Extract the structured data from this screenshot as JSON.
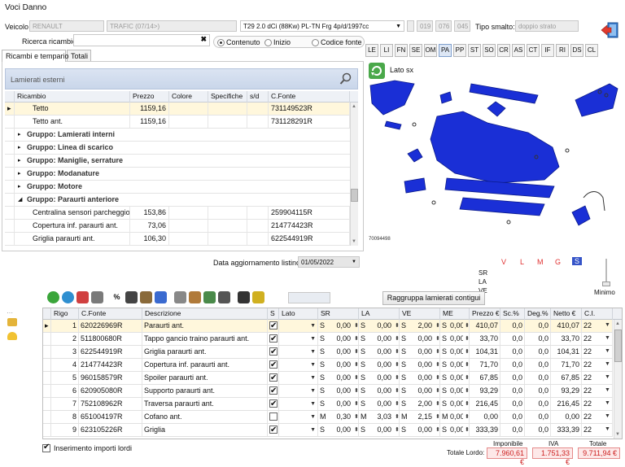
{
  "window": {
    "title": "Voci Danno"
  },
  "header": {
    "veicolo_label": "Veicolo",
    "make": "RENAULT",
    "model": "TRAFIC (07/14>)",
    "version": "T29 2.0 dCi (88Kw) PL-TN Frg 4p/d/1997cc",
    "codes": [
      "019",
      "076",
      "045"
    ],
    "smalto_label": "Tipo smalto:",
    "smalto_value": "doppio strato"
  },
  "search": {
    "label": "Ricerca ricambio",
    "value": "",
    "clear": "✖"
  },
  "search_mode": {
    "options": [
      "Contenuto",
      "Inizio",
      "Codice fonte"
    ],
    "selected": "Contenuto"
  },
  "left_tabs": [
    "Ricambi e tempario",
    "Totali"
  ],
  "group_title": "Lamierati esterni",
  "parts_columns": [
    "Ricambio",
    "Prezzo",
    "Colore",
    "Specifiche",
    "s/d",
    "C.Fonte"
  ],
  "parts_rows": [
    {
      "type": "item",
      "name": "Tetto",
      "price": "1159,16",
      "code": "731149523R",
      "current": true
    },
    {
      "type": "item",
      "name": "Tetto ant.",
      "price": "1159,16",
      "code": "731128291R"
    },
    {
      "type": "group",
      "name": "Gruppo: Lamierati interni"
    },
    {
      "type": "group",
      "name": "Gruppo: Linea di scarico"
    },
    {
      "type": "group",
      "name": "Gruppo: Maniglie, serrature"
    },
    {
      "type": "group",
      "name": "Gruppo: Modanature"
    },
    {
      "type": "group",
      "name": "Gruppo: Motore"
    },
    {
      "type": "group",
      "name": "Gruppo: Paraurti anteriore",
      "expanded": true
    },
    {
      "type": "item",
      "name": "Centralina sensori parcheggio",
      "price": "153,86",
      "code": "259904115R"
    },
    {
      "type": "item",
      "name": "Copertura inf. paraurti ant.",
      "price": "73,06",
      "code": "214774423R"
    },
    {
      "type": "item",
      "name": "Griglia paraurti ant.",
      "price": "106,30",
      "code": "622544919R"
    }
  ],
  "section_tabs": [
    "LE",
    "LI",
    "FN",
    "SE",
    "OM",
    "PA",
    "PP",
    "ST",
    "SO",
    "CR",
    "AS",
    "CT",
    "IF",
    "RI",
    "DS",
    "CL"
  ],
  "section_selected": "PA",
  "view": {
    "side_label": "Lato sx",
    "image_code": "70094498"
  },
  "legend": {
    "letters": [
      "V",
      "L",
      "M",
      "G",
      "S"
    ],
    "selected": "S",
    "row_labels": [
      "SR",
      "LA",
      "VE"
    ],
    "minimo_label": "Minimo"
  },
  "listino": {
    "label": "Data aggiornamento listino:",
    "date": "01/05/2022"
  },
  "group_button": "Raggruppa lamierati contigui",
  "toolbar_icons": [
    "add-icon",
    "refresh-icon",
    "eraser-icon",
    "calculator-icon",
    "percent-icon",
    "document-icon",
    "diamond-icon",
    "grid-icon",
    "gear-icon",
    "box-icon",
    "image-icon",
    "binoculars-icon",
    "motorcycle-icon",
    "barcode-icon"
  ],
  "labor_columns": [
    "Rigo",
    "C.Fonte",
    "Descrizione",
    "S",
    "Lato",
    "SR",
    "LA",
    "VE",
    "ME",
    "Prezzo €",
    "Sc.%",
    "Deg.%",
    "Netto €",
    "C.I."
  ],
  "labor_rows": [
    {
      "rigo": "1",
      "code": "620226969R",
      "desc": "Paraurti ant.",
      "s": true,
      "lato": "",
      "sr_op": "S",
      "sr": "0,00",
      "la_op": "S",
      "la": "0,00",
      "ve_op": "S",
      "ve": "2,00",
      "me_op": "S",
      "me": "0,00",
      "price": "410,07",
      "sc": "0,0",
      "deg": "0,0",
      "netto": "410,07",
      "ci": "22"
    },
    {
      "rigo": "2",
      "code": "511800680R",
      "desc": "Tappo gancio traino paraurti ant.",
      "s": true,
      "lato": "",
      "sr_op": "S",
      "sr": "0,00",
      "la_op": "S",
      "la": "0,00",
      "ve_op": "S",
      "ve": "0,00",
      "me_op": "S",
      "me": "0,00",
      "price": "33,70",
      "sc": "0,0",
      "deg": "0,0",
      "netto": "33,70",
      "ci": "22"
    },
    {
      "rigo": "3",
      "code": "622544919R",
      "desc": "Griglia paraurti ant.",
      "s": true,
      "lato": "",
      "sr_op": "S",
      "sr": "0,00",
      "la_op": "S",
      "la": "0,00",
      "ve_op": "S",
      "ve": "0,00",
      "me_op": "S",
      "me": "0,00",
      "price": "104,31",
      "sc": "0,0",
      "deg": "0,0",
      "netto": "104,31",
      "ci": "22"
    },
    {
      "rigo": "4",
      "code": "214774423R",
      "desc": "Copertura inf. paraurti ant.",
      "s": true,
      "lato": "",
      "sr_op": "S",
      "sr": "0,00",
      "la_op": "S",
      "la": "0,00",
      "ve_op": "S",
      "ve": "0,00",
      "me_op": "S",
      "me": "0,00",
      "price": "71,70",
      "sc": "0,0",
      "deg": "0,0",
      "netto": "71,70",
      "ci": "22"
    },
    {
      "rigo": "5",
      "code": "960158579R",
      "desc": "Spoiler paraurti ant.",
      "s": true,
      "lato": "",
      "sr_op": "S",
      "sr": "0,00",
      "la_op": "S",
      "la": "0,00",
      "ve_op": "S",
      "ve": "0,00",
      "me_op": "S",
      "me": "0,00",
      "price": "67,85",
      "sc": "0,0",
      "deg": "0,0",
      "netto": "67,85",
      "ci": "22"
    },
    {
      "rigo": "6",
      "code": "620905080R",
      "desc": "Supporto paraurti ant.",
      "s": true,
      "lato": "",
      "sr_op": "S",
      "sr": "0,00",
      "la_op": "S",
      "la": "0,00",
      "ve_op": "S",
      "ve": "0,00",
      "me_op": "S",
      "me": "0,00",
      "price": "93,29",
      "sc": "0,0",
      "deg": "0,0",
      "netto": "93,29",
      "ci": "22"
    },
    {
      "rigo": "7",
      "code": "752108962R",
      "desc": "Traversa paraurti ant.",
      "s": true,
      "lato": "",
      "sr_op": "S",
      "sr": "0,00",
      "la_op": "S",
      "la": "0,00",
      "ve_op": "S",
      "ve": "2,00",
      "me_op": "S",
      "me": "0,00",
      "price": "216,45",
      "sc": "0,0",
      "deg": "0,0",
      "netto": "216,45",
      "ci": "22"
    },
    {
      "rigo": "8",
      "code": "651004197R",
      "desc": "Cofano ant.",
      "s": false,
      "lato": "",
      "sr_op": "M",
      "sr": "0,30",
      "la_op": "M",
      "la": "3,03",
      "ve_op": "M",
      "ve": "2,15",
      "me_op": "M",
      "me": "0,00",
      "price": "0,00",
      "sc": "0,0",
      "deg": "0,0",
      "netto": "0,00",
      "ci": "22"
    },
    {
      "rigo": "9",
      "code": "623105226R",
      "desc": "Griglia",
      "s": true,
      "lato": "",
      "sr_op": "S",
      "sr": "0,00",
      "la_op": "S",
      "la": "0,00",
      "ve_op": "S",
      "ve": "0,00",
      "me_op": "S",
      "me": "0,00",
      "price": "333,39",
      "sc": "0,0",
      "deg": "0,0",
      "netto": "333,39",
      "ci": "22"
    }
  ],
  "footer": {
    "checkbox_label": "Inserimento importi lordi",
    "totale_lordo_label": "Totale Lordo:",
    "imponibile_label": "Imponibile",
    "iva_label": "IVA",
    "totale_label": "Totale",
    "imponibile": "7.960,61 €",
    "iva": "1.751,33 €",
    "totale": "9.711,94 €"
  }
}
